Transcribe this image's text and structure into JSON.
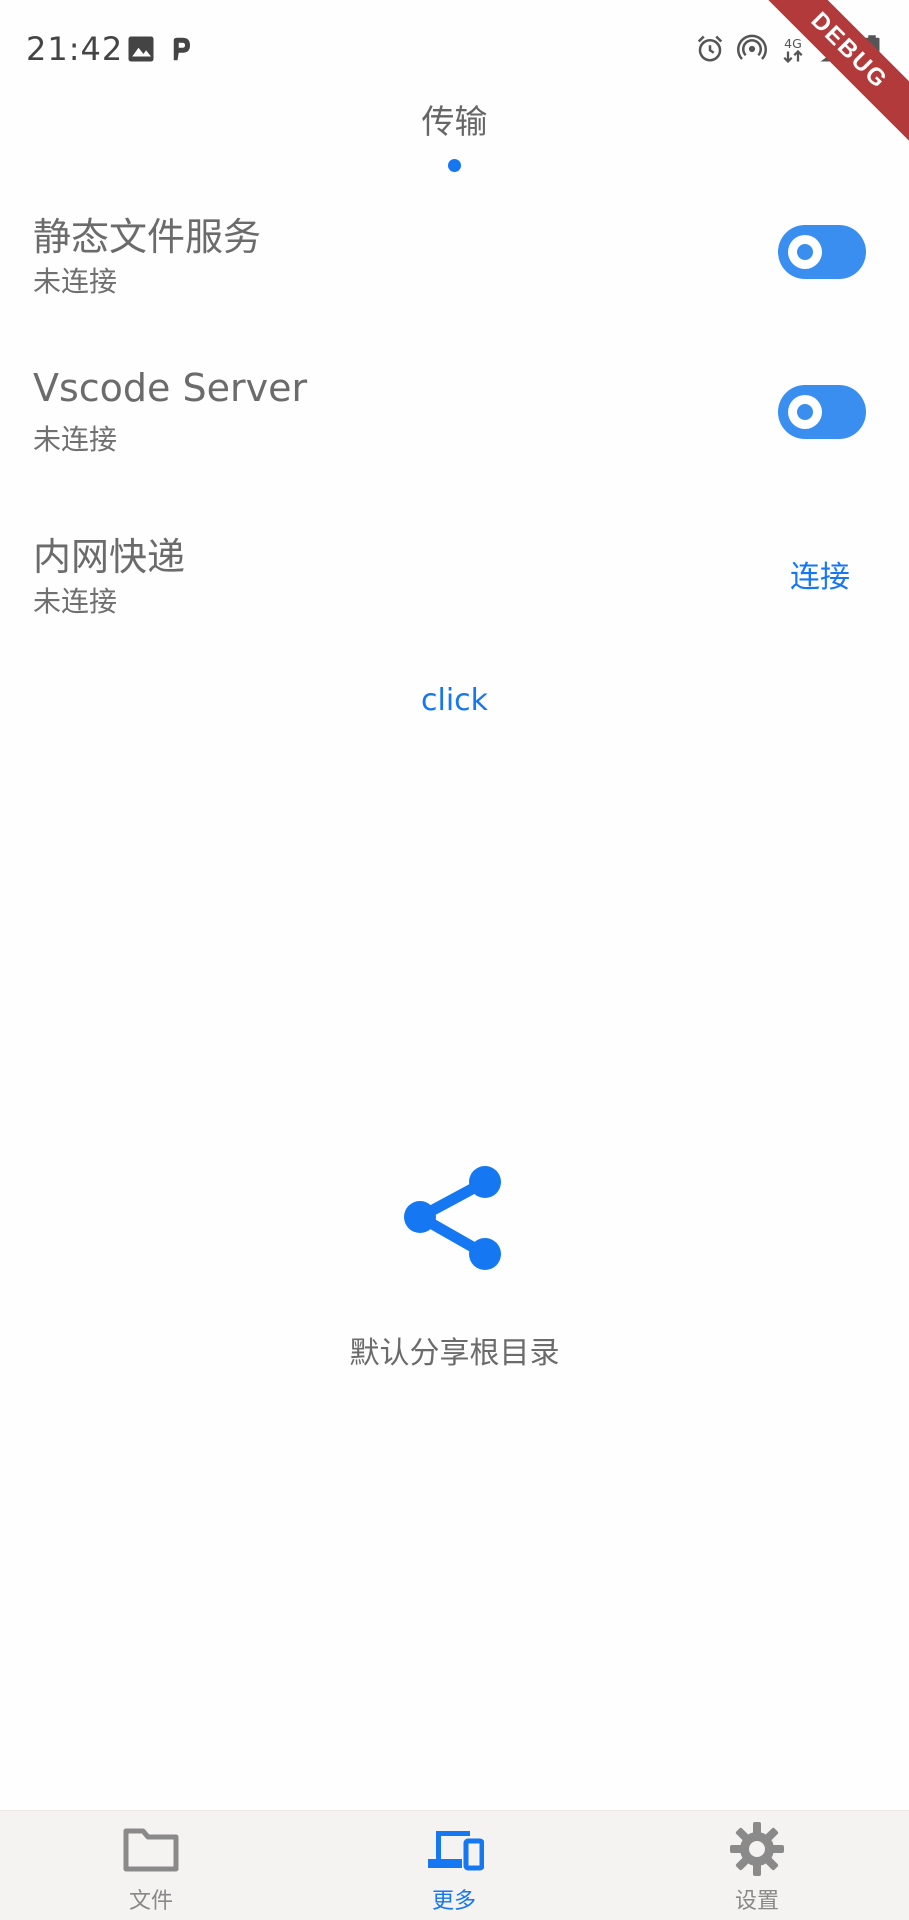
{
  "status_bar": {
    "time": "21:42",
    "icons": [
      "image-icon",
      "parking-icon",
      "alarm-icon",
      "hotspot-icon",
      "network-4g-icon",
      "signal-icon",
      "battery-icon"
    ],
    "network_label": "4G"
  },
  "debug_banner": "DEBUG",
  "top_tab": {
    "label": "传输"
  },
  "rows": [
    {
      "title": "静态文件服务",
      "status": "未连接",
      "control": "toggle",
      "enabled": true
    },
    {
      "title": "Vscode Server",
      "status": "未连接",
      "control": "toggle",
      "enabled": true
    },
    {
      "title": "内网快递",
      "status": "未连接",
      "control": "button",
      "button_label": "连接"
    }
  ],
  "click_button": "click",
  "share": {
    "icon": "share-icon",
    "caption": "默认分享根目录"
  },
  "bottom_nav": [
    {
      "label": "文件",
      "icon": "folder-icon",
      "active": false
    },
    {
      "label": "更多",
      "icon": "devices-icon",
      "active": true
    },
    {
      "label": "设置",
      "icon": "gear-icon",
      "active": false
    }
  ],
  "colors": {
    "accent": "#1577f2",
    "toggle": "#3a8ef0",
    "text": "#6b6b6b",
    "nav_bg": "#f5f2f2",
    "debug": "#b23a3a"
  }
}
